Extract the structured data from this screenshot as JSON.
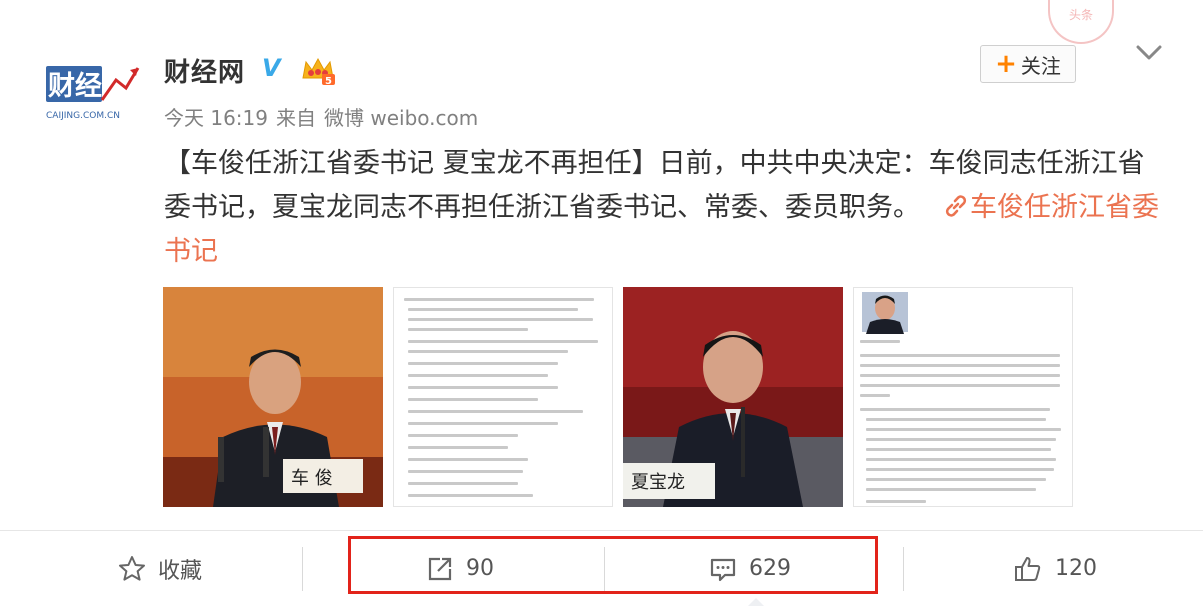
{
  "post": {
    "author": "财经网",
    "verified_badge": "V",
    "avatar_text_main": "财经网",
    "avatar_text_sub": "CAIJING.COM.CN",
    "time": "今天 16:19",
    "source_prefix": "来自",
    "source": "微博 weibo.com",
    "follow_label": "关注",
    "vip_level": "5",
    "stamp_text": "头条",
    "text_main": "【车俊任浙江省委书记  夏宝龙不再担任】日前，中共中央决定：车俊同志任浙江省委书记，夏宝龙同志不再担任浙江省委书记、常委、委员职务。",
    "link_text": "车俊任浙江省委书记",
    "image_labels": {
      "photo1_nameplate": "车 俊",
      "photo3_nameplate": "夏宝龙"
    }
  },
  "actions": {
    "favorite_label": "收藏",
    "repost_count": "90",
    "comment_count": "629",
    "like_count": "120"
  },
  "icons": [
    "chevron-down-icon",
    "verified-icon",
    "vip-crown-icon",
    "plus-icon",
    "link-icon",
    "star-icon",
    "repost-icon",
    "comment-icon",
    "like-icon"
  ],
  "colors": {
    "link": "#eb7350",
    "follow_plus": "#ff8200",
    "verified": "#3aa9e8",
    "highlight_box": "#e2231a"
  }
}
